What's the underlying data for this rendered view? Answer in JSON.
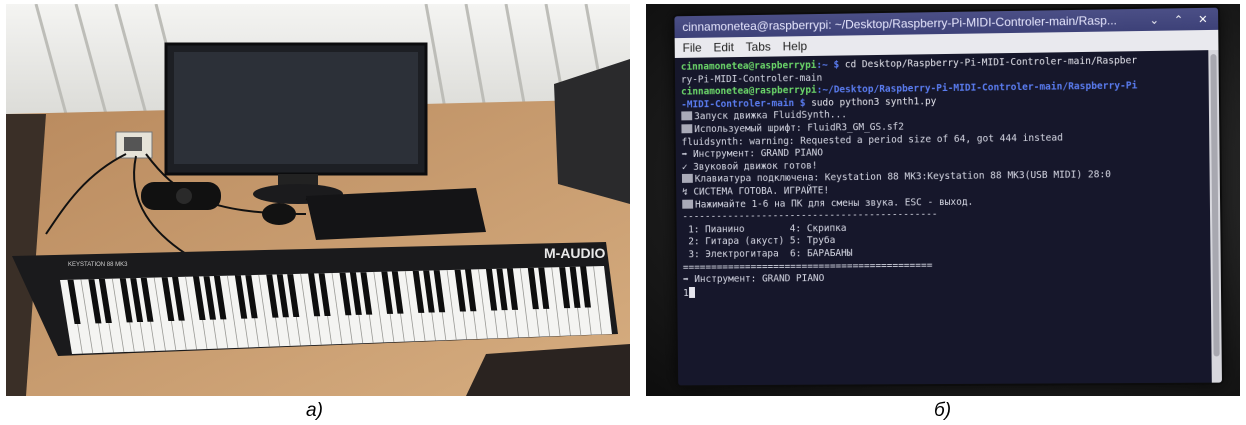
{
  "captions": {
    "a": "а)",
    "b": "б)"
  },
  "photo_a": {
    "keyboard_brand": "M-AUDIO",
    "keyboard_model": "KEYSTATION 88 MK3"
  },
  "terminal": {
    "window_title": "cinnamonetea@raspberrypi: ~/Desktop/Raspberry-Pi-MIDI-Controler-main/Rasp...",
    "menu": [
      "File",
      "Edit",
      "Tabs",
      "Help"
    ],
    "lines": {
      "l1_user": "cinnamonetea@raspberrypi",
      "l1_path": ":~ $",
      "l1_cmd": " cd Desktop/Raspberry-Pi-MIDI-Controler-main/Raspber",
      "l2": "ry-Pi-MIDI-Controler-main",
      "l3_user": "cinnamonetea@raspberrypi",
      "l3_path": ":~/Desktop/Raspberry-Pi-MIDI-Controler-main/Raspberry-Pi",
      "l4_path": "-MIDI-Controler-main $",
      "l4_cmd": " sudo python3 synth1.py",
      "l5": "Запуск движка FluidSynth...",
      "l6": "Используемый шрифт: FluidR3_GM_GS.sf2",
      "l7": "fluidsynth: warning: Requested a period size of 64, got 444 instead",
      "l8": "➡ Инструмент: GRAND PIANO",
      "l9": "✓ Звуковой движок готов!",
      "l10": "Клавиатура подключена: Keystation 88 MK3:Keystation 88 MK3(USB MIDI) 28:0",
      "l11": "↯ СИСТЕМА ГОТОВА. ИГРАЙТЕ!",
      "l12": "Нажимайте 1-6 на ПК для смены звука. ESC - выход.",
      "sep1": "---------------------------------------------",
      "m1": " 1: Пианино        4: Скрипка",
      "m2": " 2: Гитара (акуст) 5: Труба",
      "m3": " 3: Электрогитара  6: БАРАБАНЫ",
      "sep2": "============================================",
      "l13": "➡ Инструмент: GRAND PIANO",
      "l14": "1"
    }
  }
}
